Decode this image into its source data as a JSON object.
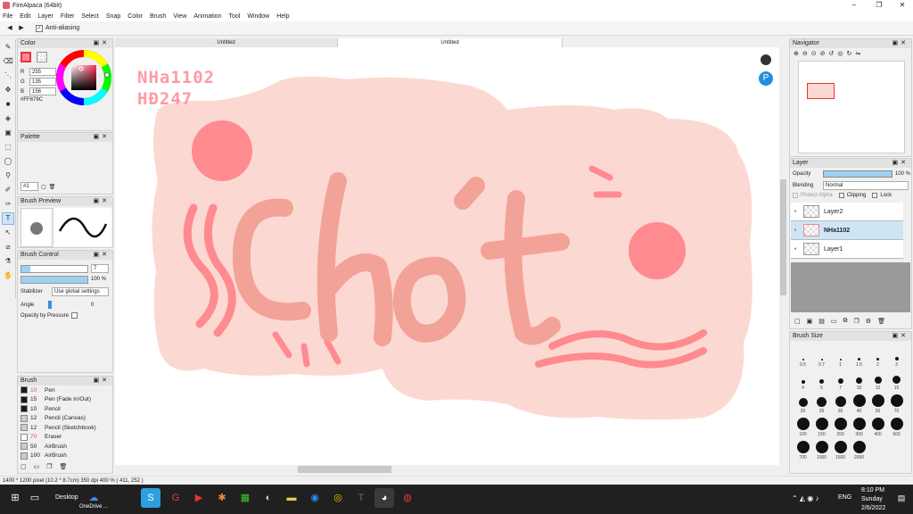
{
  "window": {
    "title": "FireAlpaca (64bit)",
    "min": "–",
    "max": "❐",
    "close": "✕"
  },
  "menu": [
    "File",
    "Edit",
    "Layer",
    "Filter",
    "Select",
    "Snap",
    "Color",
    "Brush",
    "View",
    "Animation",
    "Tool",
    "Window",
    "Help"
  ],
  "options": {
    "antialias_label": "Anti-aliasing",
    "antialias_checked": "✓"
  },
  "color_panel": {
    "title": "Color",
    "r_label": "R",
    "g_label": "G",
    "b_label": "B",
    "r": "255",
    "g": "135",
    "b": "156",
    "hex": "#FF879C",
    "current_color": "#ff879c"
  },
  "palette_panel": {
    "title": "Palette",
    "select": "#1"
  },
  "brush_preview": {
    "title": "Brush Preview"
  },
  "brush_control": {
    "title": "Brush Control",
    "size": "7",
    "opacity": "100 %",
    "stabilizer_label": "Stabilizer",
    "stabilizer_value": "Use global settings",
    "angle_label": "Angle",
    "angle_value": "0",
    "opacity_pressure_label": "Opacity by Pressure"
  },
  "brush_panel": {
    "title": "Brush",
    "items": [
      {
        "size": "10",
        "name": "Pen",
        "color": "#1a1a1a",
        "num_color": "#e05050"
      },
      {
        "size": "15",
        "name": "Pen (Fade In/Out)",
        "color": "#1a1a1a",
        "num_color": "#222"
      },
      {
        "size": "10",
        "name": "Pencil",
        "color": "#1a1a1a",
        "num_color": "#222"
      },
      {
        "size": "12",
        "name": "Pencil (Canvas)",
        "color": "#cccccc",
        "num_color": "#222"
      },
      {
        "size": "12",
        "name": "Pencil (Sketchbook)",
        "color": "#cccccc",
        "num_color": "#222"
      },
      {
        "size": "70",
        "name": "Eraser",
        "color": "#ffffff",
        "num_color": "#e05050"
      },
      {
        "size": "50",
        "name": "AirBrush",
        "color": "#cccccc",
        "num_color": "#222"
      },
      {
        "size": "100",
        "name": "AirBrush",
        "color": "#cccccc",
        "num_color": "#222"
      }
    ]
  },
  "tabs": [
    "Untitled",
    "Untitled"
  ],
  "canvas_art": {
    "text_line1": "NHa1102",
    "text_line2": "HĐ247",
    "word": "Chót",
    "text_color": "#ff9aa6",
    "bg_blob": "#fbd9d2",
    "letters": "#f5a39a",
    "accent": "#ff7f8a"
  },
  "status": {
    "info": "1400 * 1200 pixel   (10.2 * 8.7cm)   350 dpi   400 %   ( 411, 252 )"
  },
  "navigator": {
    "title": "Navigator"
  },
  "layer_panel": {
    "title": "Layer",
    "opacity_label": "Opacity",
    "opacity_value": "100 %",
    "blending_label": "Blending",
    "blending_value": "Normal",
    "protect_alpha": "Protect Alpha",
    "clipping": "Clipping",
    "lock": "Lock",
    "layers": [
      {
        "name": "Layer2",
        "selected": false
      },
      {
        "name": "NHa1102",
        "selected": true
      },
      {
        "name": "Layer1",
        "selected": false
      }
    ]
  },
  "brush_size_panel": {
    "title": "Brush Size",
    "sizes": [
      "0.5",
      "0.7",
      "1",
      "1.5",
      "2",
      "3",
      "4",
      "5",
      "7",
      "10",
      "12",
      "15",
      "20",
      "25",
      "30",
      "40",
      "50",
      "70",
      "100",
      "150",
      "200",
      "300",
      "400",
      "500",
      "700",
      "1000",
      "1500",
      "2000"
    ]
  },
  "taskbar": {
    "desktop_label": "Desktop",
    "onedrive_label": "OneDrive ...",
    "lang": "ENG",
    "time": "8:10 PM",
    "day": "Sunday",
    "date": "2/6/2022"
  }
}
